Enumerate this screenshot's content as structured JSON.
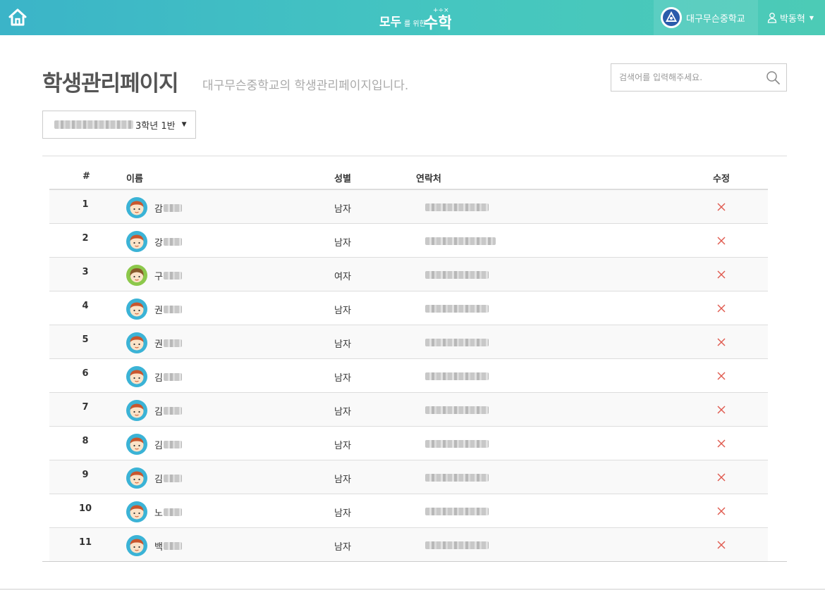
{
  "navbar": {
    "logo_text": "모두를 위한 수학",
    "school_name": "대구무슨중학교",
    "user_name": "박동혁"
  },
  "header": {
    "title": "학생관리페이지",
    "subtitle": "대구무슨중학교의 학생관리페이지입니다.",
    "search_placeholder": "검색어를 입력해주세요."
  },
  "class_select": {
    "selected": "3학년 1반"
  },
  "table": {
    "headers": {
      "num": "#",
      "name": "이름",
      "gender": "성별",
      "contact": "연락처",
      "edit": "수정"
    },
    "rows": [
      {
        "num": "1",
        "name": "감",
        "gender": "남자",
        "avatar": "boy"
      },
      {
        "num": "2",
        "name": "강",
        "gender": "남자",
        "avatar": "boy"
      },
      {
        "num": "3",
        "name": "구",
        "gender": "여자",
        "avatar": "girl"
      },
      {
        "num": "4",
        "name": "권",
        "gender": "남자",
        "avatar": "boy"
      },
      {
        "num": "5",
        "name": "권",
        "gender": "남자",
        "avatar": "boy"
      },
      {
        "num": "6",
        "name": "김",
        "gender": "남자",
        "avatar": "boy"
      },
      {
        "num": "7",
        "name": "김",
        "gender": "남자",
        "avatar": "boy"
      },
      {
        "num": "8",
        "name": "김",
        "gender": "남자",
        "avatar": "boy"
      },
      {
        "num": "9",
        "name": "김",
        "gender": "남자",
        "avatar": "boy"
      },
      {
        "num": "10",
        "name": "노",
        "gender": "남자",
        "avatar": "boy"
      },
      {
        "num": "11",
        "name": "백",
        "gender": "남자",
        "avatar": "boy"
      }
    ]
  },
  "colors": {
    "nav_start": "#3bb4c8",
    "nav_end": "#4ccbb6",
    "delete_red": "#e05a4f",
    "avatar_boy_bg": "#3bb3d6",
    "avatar_girl_bg": "#8cc84b"
  },
  "icons": {
    "home": "home-icon",
    "search": "search-icon",
    "user": "user-icon",
    "delete": "close-icon"
  }
}
